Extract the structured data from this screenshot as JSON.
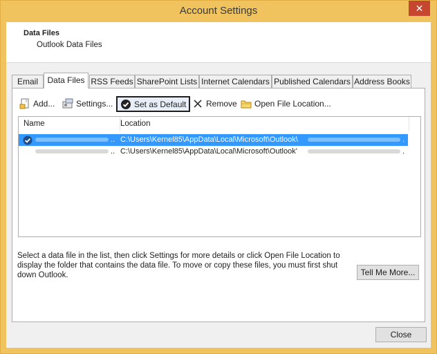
{
  "window": {
    "title": "Account Settings",
    "close_glyph": "✕"
  },
  "header": {
    "title": "Data Files",
    "subtitle": "Outlook Data Files"
  },
  "tabs": [
    {
      "label": "Email"
    },
    {
      "label": "Data Files"
    },
    {
      "label": "RSS Feeds"
    },
    {
      "label": "SharePoint Lists"
    },
    {
      "label": "Internet Calendars"
    },
    {
      "label": "Published Calendars"
    },
    {
      "label": "Address Books"
    }
  ],
  "toolbar": {
    "add_label": "Add...",
    "settings_label": "Settings...",
    "set_default_label": "Set as Default",
    "remove_label": "Remove",
    "open_location_label": "Open File Location..."
  },
  "table": {
    "columns": [
      "Name",
      "Location"
    ],
    "rows": [
      {
        "location": "C:\\Users\\Kernel85\\AppData\\Local\\Microsoft\\Outlook\\",
        "default": true
      },
      {
        "location": "C:\\Users\\Kernel85\\AppData\\Local\\Microsoft\\Outlook'",
        "default": false
      }
    ]
  },
  "description": "Select a data file in the list, then click Settings for more details or click Open File Location to display the folder that contains the data file. To move or copy these files, you must first shut down Outlook.",
  "buttons": {
    "tell_me_more": "Tell Me More...",
    "close": "Close"
  },
  "colors": {
    "frame": "#f0c35f",
    "selection": "#3399ff",
    "close_button": "#c7462f"
  }
}
